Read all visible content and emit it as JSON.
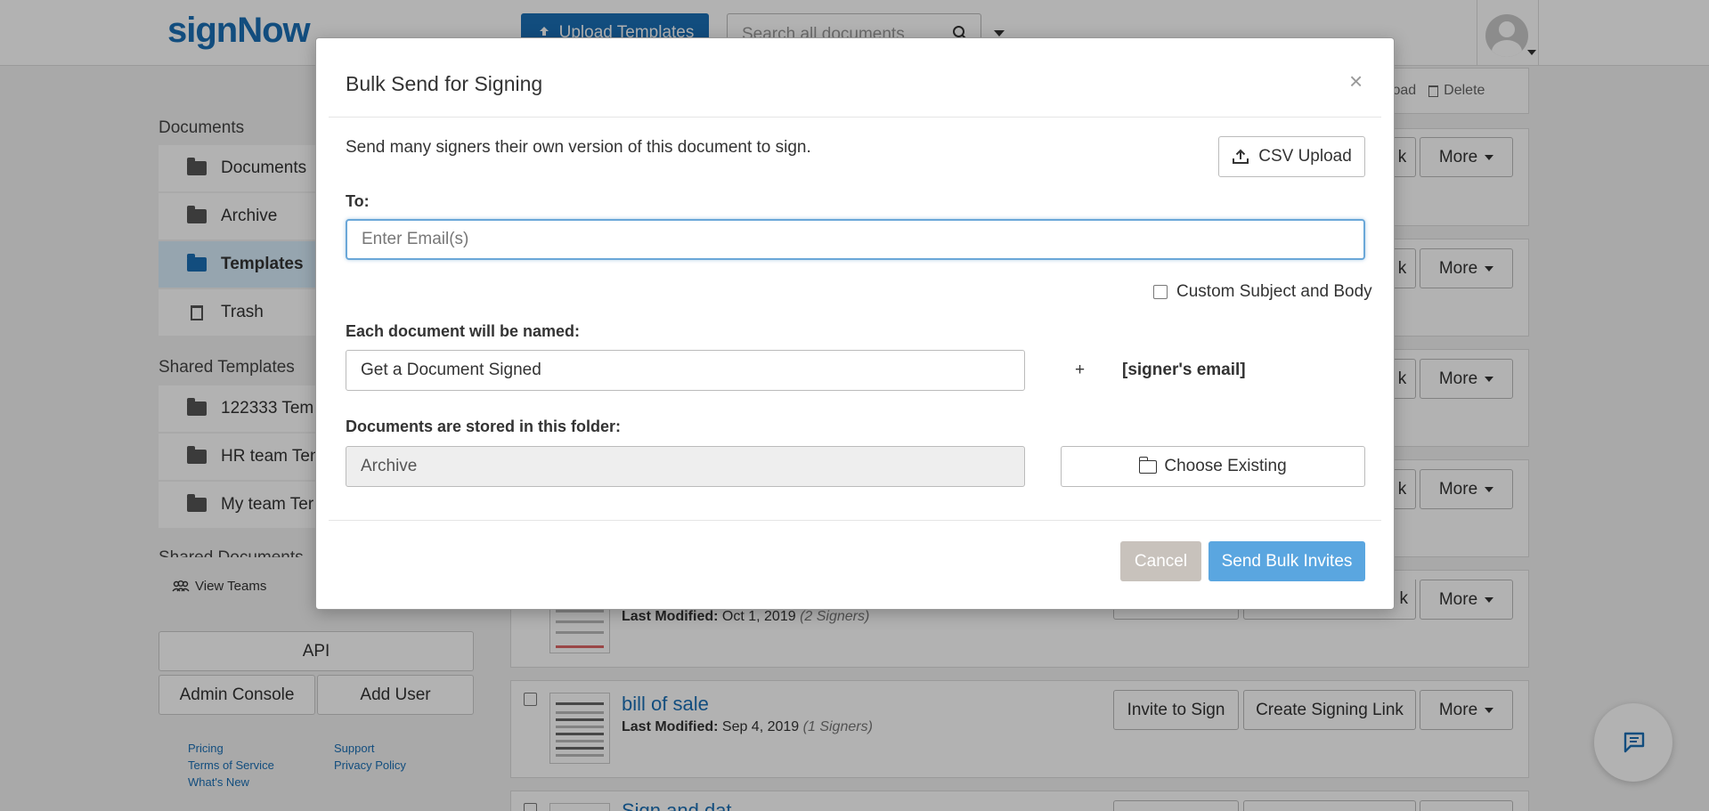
{
  "header": {
    "logo": "signNow",
    "upload_label": "Upload Templates",
    "search_placeholder": "Search all documents"
  },
  "sidebar": {
    "documents_title": "Documents",
    "items": [
      {
        "label": "Documents"
      },
      {
        "label": "Archive"
      },
      {
        "label": "Templates"
      },
      {
        "label": "Trash"
      }
    ],
    "shared_templates_title": "Shared Templates",
    "shared_templates": [
      {
        "label": "122333 Tem"
      },
      {
        "label": "HR team Ten"
      },
      {
        "label": "My team Ter"
      }
    ],
    "shared_documents_title": "Shared Documents",
    "view_teams": "View Teams",
    "api_label": "API",
    "admin_console_label": "Admin Console",
    "add_user_label": "Add User",
    "footer_links": {
      "pricing": "Pricing",
      "terms": "Terms of Service",
      "whats_new": "What's New",
      "support": "Support",
      "privacy": "Privacy Policy"
    }
  },
  "main": {
    "top_actions": {
      "download": "nload",
      "delete": "Delete"
    },
    "more_label": "More",
    "partial_k": "k",
    "invite_label": "Invite to Sign",
    "signing_link_label": "Create Signing Link",
    "last_modified_label": "Last Modified:",
    "rows": [
      {
        "date": "Oct 1, 2019",
        "signers": "(2 Signers)"
      },
      {
        "title": "bill of sale",
        "date": "Sep 4, 2019",
        "signers": "(1 Signers)"
      },
      {
        "title": "Sign and dat"
      }
    ]
  },
  "modal": {
    "title": "Bulk Send for Signing",
    "close": "×",
    "description": "Send many signers their own version of this document to sign.",
    "csv_label": "CSV Upload",
    "to_label": "To:",
    "email_placeholder": "Enter Email(s)",
    "custom_subject_label": "Custom Subject and Body",
    "named_label": "Each document will be named:",
    "name_value": "Get a Document Signed",
    "plus": "+",
    "signer_email": "[signer's email]",
    "folder_label": "Documents are stored in this folder:",
    "folder_value": "Archive",
    "choose_label": "Choose Existing",
    "cancel_label": "Cancel",
    "send_label": "Send Bulk Invites"
  },
  "colors": {
    "brand": "#1a6fb5",
    "send": "#5aa6e0",
    "cancel": "#c8c2bc",
    "focus": "#6aa7d8"
  }
}
